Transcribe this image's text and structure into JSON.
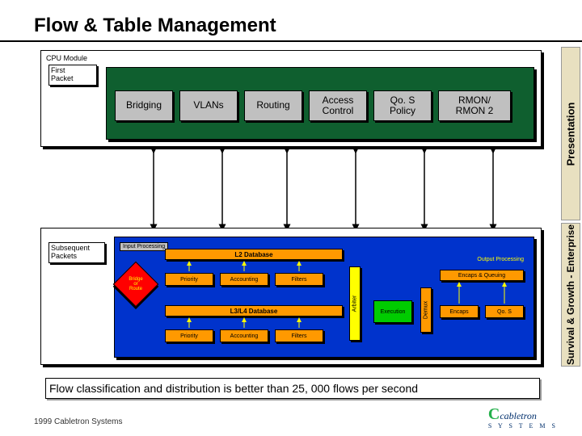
{
  "title": "Flow & Table Management",
  "sideTabs": {
    "presentation": "Presentation",
    "survival": "Survival & Growth - Enterprise"
  },
  "cpu": {
    "label": "CPU Module",
    "firstPacket": "First\nPacket",
    "modules": [
      "Bridging",
      "VLANs",
      "Routing",
      "Access\nControl",
      "Qo. S\nPolicy",
      "RMON/\nRMON 2"
    ]
  },
  "switch": {
    "subsequent": "Subsequent\nPackets",
    "inputProc": "Input Processing",
    "outputProc": "Output Processing",
    "l2db": "L2 Database",
    "l34db": "L3/L4 Database",
    "diamond": "Bridge\nor\nRoute",
    "row": {
      "priority": "Priority",
      "accounting": "Accounting",
      "filters": "Filters"
    },
    "arbiter": "Arbiter",
    "execution": "Execution",
    "demux": "Demux",
    "encapsQ": "Encaps & Queuing",
    "encaps": "Encaps",
    "qos": "Qo. S"
  },
  "footer": "Flow classification and distribution is better than 25, 000 flows per second",
  "copyright": "1999 Cabletron Systems",
  "logo": {
    "brand": "cabletron",
    "sub": "S Y S T E M S"
  }
}
